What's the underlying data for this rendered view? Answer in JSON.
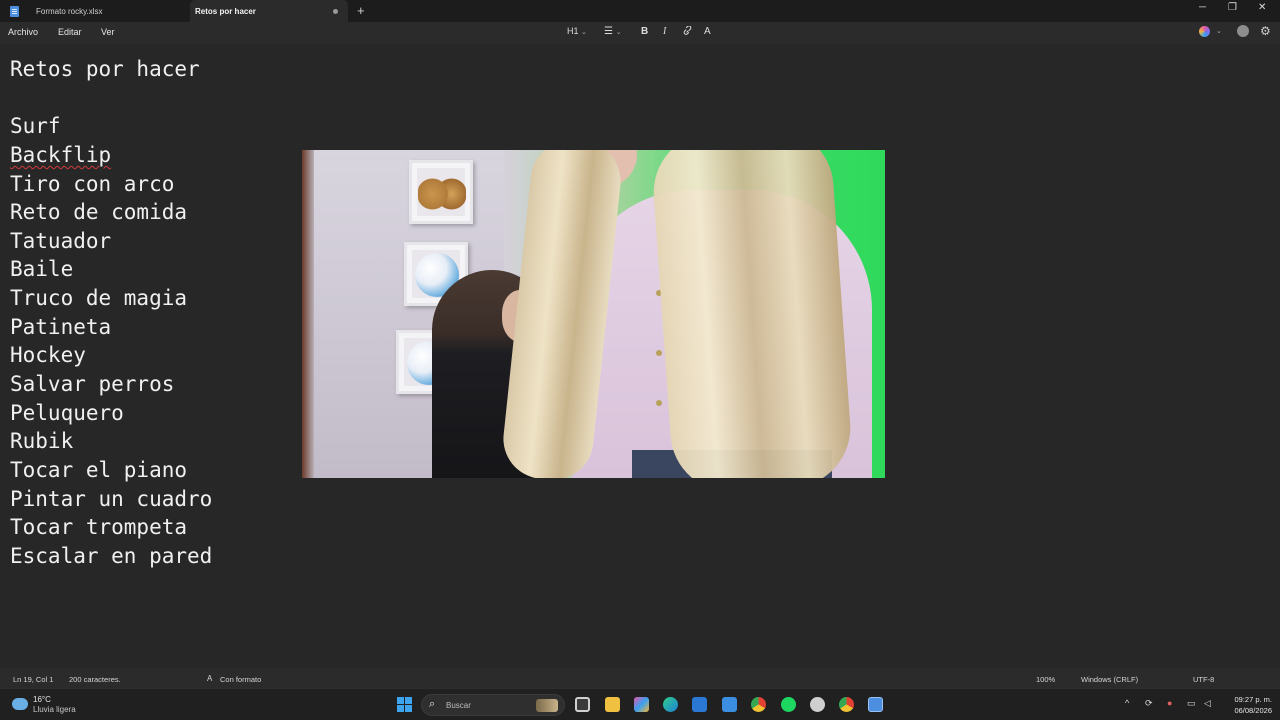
{
  "tabs": [
    {
      "label": "Formato rocky.xlsx",
      "active": false
    },
    {
      "label": "Retos por hacer",
      "active": true
    }
  ],
  "window_controls": {
    "minimize": "─",
    "restore": "❐",
    "close": "✕",
    "new_tab": "+"
  },
  "menu": {
    "archivo": "Archivo",
    "editar": "Editar",
    "ver": "Ver"
  },
  "toolbar": {
    "heading": "H1",
    "list": "☰",
    "bold": "B",
    "italic": "I",
    "link": "🔗",
    "clear_format": "A"
  },
  "document": {
    "lines": [
      "Retos por hacer",
      "",
      "Surf",
      "Backflip",
      "Tiro con arco",
      "Reto de comida",
      "Tatuador",
      "Baile",
      "Truco de magia",
      "Patineta",
      "Hockey",
      "Salvar perros",
      "Peluquero",
      "Rubik",
      "Tocar el piano",
      "Pintar un cuadro",
      "Tocar trompeta",
      "Escalar en pared"
    ],
    "misspelled_line_index": 3
  },
  "status": {
    "position": "Ln 19, Col 1",
    "chars": "200 caracteres.",
    "format": "Con formato",
    "zoom": "100%",
    "line_ending": "Windows (CRLF)",
    "encoding": "UTF-8"
  },
  "taskbar": {
    "weather_temp": "16°C",
    "weather_desc": "Lluvia ligera",
    "search_placeholder": "Buscar",
    "clock_time": "09:27 p. m.",
    "clock_date": "06/08/2026",
    "apps": [
      "file-explorer-icon",
      "copilot-icon",
      "edge-icon",
      "store-icon",
      "remote-icon",
      "chrome-icon",
      "spotify-icon",
      "steam-icon",
      "chrome-icon",
      "notepad-icon"
    ]
  },
  "colors": {
    "background": "#272727",
    "tabbar": "#1c1c1c",
    "text": "#f0f0f0",
    "spellcheck": "#d13b3b",
    "accent": "#3fa4f0"
  }
}
